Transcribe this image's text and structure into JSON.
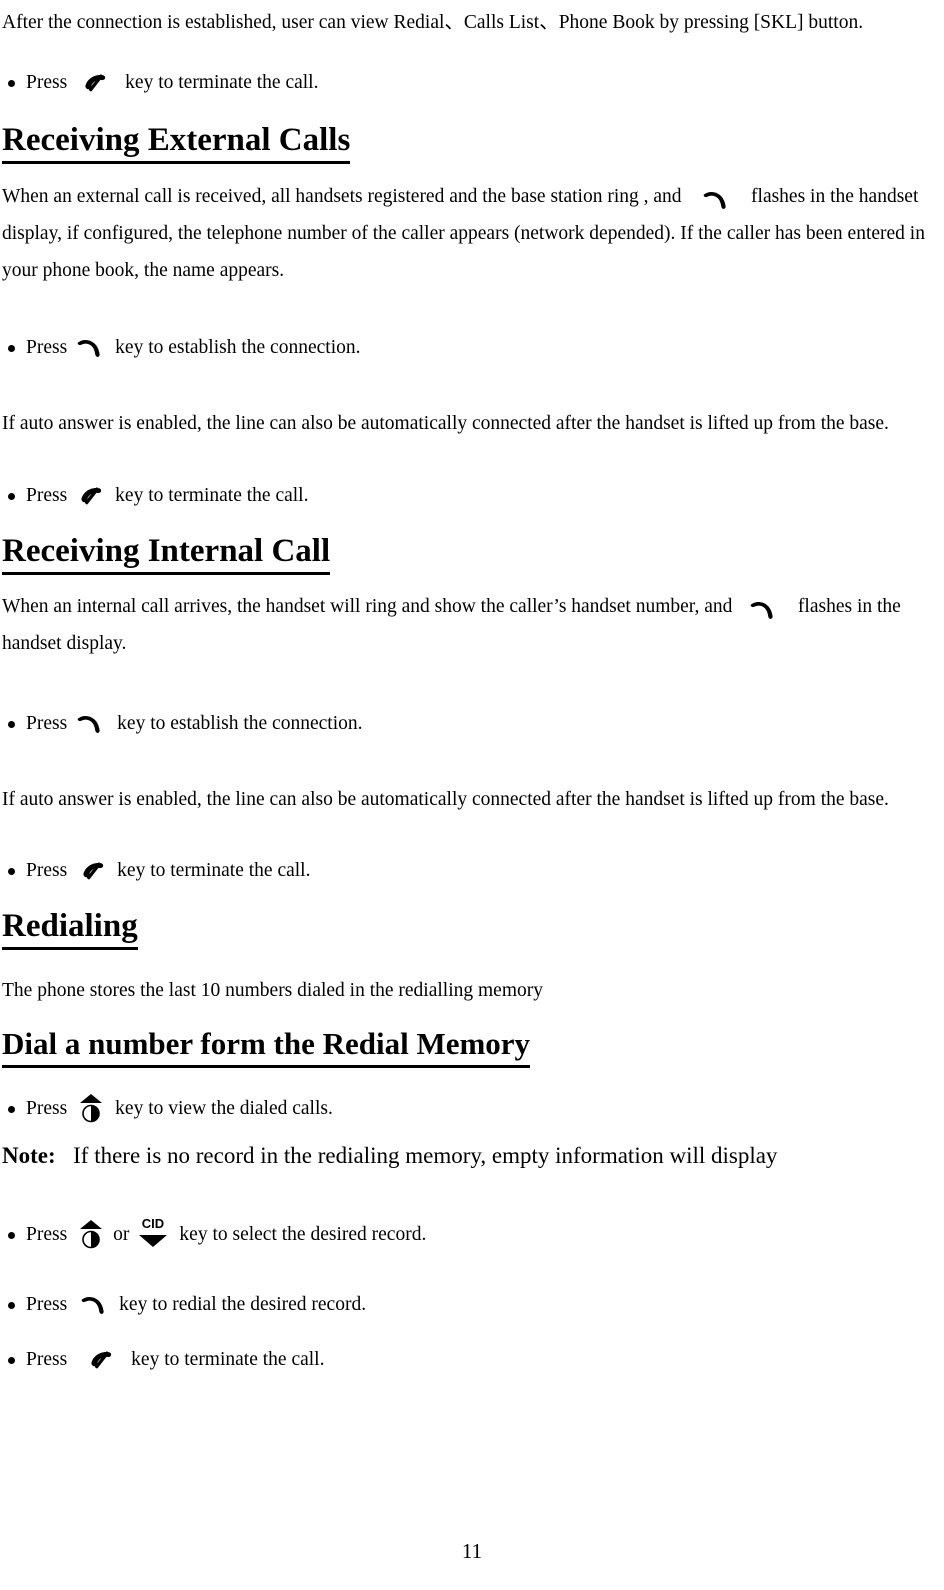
{
  "document": {
    "page_number": "11",
    "intro_line": "After the connection is established, user can view Redial、Calls List、Phone Book by pressing [SKL] button."
  },
  "bullets": {
    "terminate_1": {
      "press": "Press",
      "tail": "key to terminate the call.",
      "icon": "end-call-icon"
    },
    "establish_1": {
      "press": "Press",
      "tail": "key to establish the connection.",
      "icon": "off-hook-icon"
    },
    "terminate_2": {
      "press": "Press",
      "tail": "key to terminate the call.",
      "icon": "end-call-icon"
    },
    "establish_2": {
      "press": "Press",
      "tail": "key to establish the connection.",
      "icon": "off-hook-icon"
    },
    "terminate_3": {
      "press": "Press",
      "tail": "key to terminate the call.",
      "icon": "end-call-icon"
    },
    "view_dialed": {
      "press": "Press",
      "tail": "key to view the dialed calls.",
      "icon": "up-scroll-icon"
    },
    "select_record": {
      "press": "Press",
      "middle": "or",
      "tail": "key to select the desired record.",
      "icon_a": "up-scroll-icon",
      "icon_b": "cid-down-icon"
    },
    "redial_record": {
      "press": "Press",
      "tail": "key to redial the desired record.",
      "icon": "off-hook-icon"
    },
    "terminate_4": {
      "press": "Press",
      "tail": "key to terminate the call.",
      "icon": "end-call-icon"
    }
  },
  "sections": {
    "receiving_external": {
      "heading": "Receiving External Calls",
      "para_part1": "When an external call is received, all handsets registered and the base station ring , and",
      "para_part2": "flashes in the handset display, if configured, the telephone number of the caller appears (network depended). If the caller has been entered in your phone book, the name appears."
    },
    "auto_answer_1": "If auto answer is enabled, the line can also be automatically connected after the handset is lifted up from the base.",
    "receiving_internal": {
      "heading": "Receiving Internal Call",
      "para_part1": "When an internal call arrives, the handset will ring and show the caller’s handset number, and",
      "para_part2": "flashes in the handset display."
    },
    "auto_answer_2": "If auto answer is enabled, the line can also be automatically connected after the handset is lifted up from the base.",
    "redialing": {
      "heading": "Redialing",
      "para": "The phone stores the last 10 numbers dialed in the redialling memory"
    },
    "dial_from_memory": {
      "heading": "Dial a number form the Redial Memory",
      "note_label": "Note:",
      "note_text": "If there is no record in the redialing memory, empty information will display"
    }
  },
  "icon_labels": {
    "cid": "CID"
  },
  "colors": {
    "text": "#000000",
    "background": "#ffffff"
  }
}
